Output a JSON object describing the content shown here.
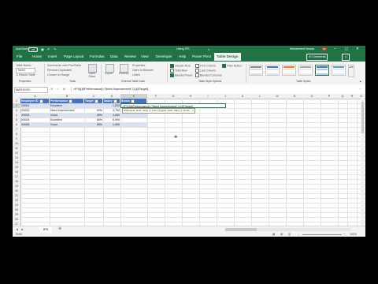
{
  "titlebar": {
    "autosave_label": "AutoSave",
    "autosave_state": "Off",
    "filename": "Using IFS",
    "user": "Mohammed Kasdar",
    "user_initials": "MK"
  },
  "tabs": [
    "File",
    "Home",
    "Insert",
    "Page Layout",
    "Formulas",
    "Data",
    "Review",
    "View",
    "Developer",
    "Help",
    "Power Pivot",
    "Table Design"
  ],
  "comments_label": "Comments",
  "ribbon": {
    "table_name_label": "Table Name:",
    "table_name_value": "Table1",
    "resize_label": "Resize Table",
    "tools": [
      "Summarize with PivotTable",
      "Remove Duplicates",
      "Convert to Range"
    ],
    "slicer_label": "Insert Slicer",
    "export_label": "Export",
    "refresh_label": "Refresh",
    "ext_items": [
      "Properties",
      "Open in Browser",
      "Unlink"
    ],
    "options_col1": [
      "Header Row",
      "Total Row",
      "Banded Rows"
    ],
    "options_col2": [
      "First Column",
      "Last Column",
      "Banded Columns"
    ],
    "filter_button": "Filter Button",
    "groups": [
      "Properties",
      "Tools",
      "External Table Data",
      "Table Style Options",
      "Table Styles"
    ]
  },
  "formula_bar": {
    "name_box": "MATHCOS...",
    "formula": "=IFS([@Performance]=\"Need Improvement\",0,[@Target]"
  },
  "columns": [
    "A",
    "B",
    "C",
    "D",
    "E",
    "F",
    "G",
    "H",
    "I",
    "J",
    "K",
    "L",
    "M",
    "N",
    "O",
    "P",
    "Q",
    "R",
    "S"
  ],
  "rows": [
    "1",
    "2",
    "3",
    "4",
    "5",
    "6",
    "7",
    "8",
    "9",
    "10",
    "11",
    "12",
    "13",
    "14",
    "15",
    "16",
    "17",
    "18",
    "19",
    "20",
    "21",
    "22",
    "23",
    "24",
    "25",
    "26",
    "27"
  ],
  "table": {
    "headers": [
      "Employee ID",
      "Performance",
      "Target",
      "Salary",
      "Bonus"
    ],
    "data": [
      [
        "X0001",
        "Excellent",
        "",
        "1,000",
        "=IFS([@Performance]=\"Need Improvement\",0,[@Target]"
      ],
      [
        "X0002",
        "Need Improvement",
        "90%",
        "3,750",
        ""
      ],
      [
        "X0003",
        "Good",
        "48%",
        "4,560",
        ""
      ],
      [
        "X0004",
        "Excellent",
        "65%",
        "6,990",
        ""
      ],
      [
        "X0005",
        "Good",
        "55%",
        "1,550",
        ""
      ]
    ]
  },
  "tooltip": "IFS(logical_test1, value_if_true1, [logical_test2, value_if_true2], ...)",
  "sheet_tab": "IFS",
  "status": {
    "ready": "Enter",
    "zoom": "100%"
  },
  "colors": {
    "accent": "#217346",
    "table_header": "#4472c4",
    "band": "#d9e1f2"
  }
}
